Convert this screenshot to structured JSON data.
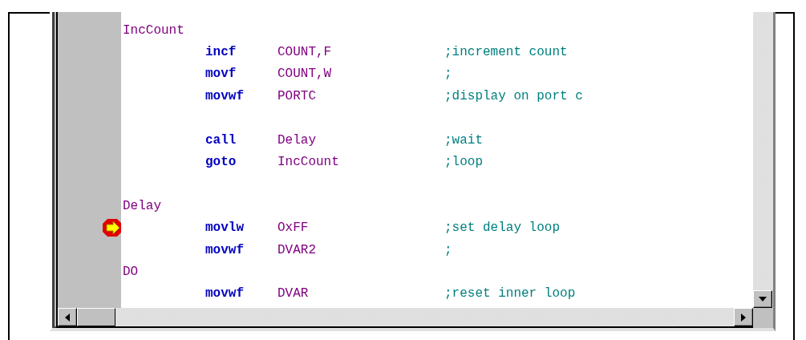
{
  "source_window": {
    "lines": [
      {
        "kind": "label",
        "label": "IncCount",
        "at_breakpoint": false
      },
      {
        "kind": "instruction",
        "mnemonic": "incf",
        "operand": "COUNT,F",
        "comment": ";increment count",
        "at_breakpoint": false
      },
      {
        "kind": "instruction",
        "mnemonic": "movf",
        "operand": "COUNT,W",
        "comment": ";",
        "at_breakpoint": false
      },
      {
        "kind": "instruction",
        "mnemonic": "movwf",
        "operand": "PORTC",
        "comment": ";display on port c",
        "at_breakpoint": false
      },
      {
        "kind": "blank",
        "at_breakpoint": false
      },
      {
        "kind": "instruction",
        "mnemonic": "call",
        "operand": "Delay",
        "comment": ";wait",
        "at_breakpoint": false
      },
      {
        "kind": "instruction",
        "mnemonic": "goto",
        "operand": "IncCount",
        "comment": ";loop",
        "at_breakpoint": false
      },
      {
        "kind": "blank",
        "at_breakpoint": false
      },
      {
        "kind": "label",
        "label": "Delay",
        "at_breakpoint": false
      },
      {
        "kind": "instruction",
        "mnemonic": "movlw",
        "operand": "OxFF",
        "comment": ";set delay loop",
        "at_breakpoint": true
      },
      {
        "kind": "instruction",
        "mnemonic": "movwf",
        "operand": "DVAR2",
        "comment": ";",
        "at_breakpoint": false
      },
      {
        "kind": "label",
        "label": "DO",
        "at_breakpoint": false
      },
      {
        "kind": "instruction",
        "mnemonic": "movwf",
        "operand": "DVAR",
        "comment": ";reset inner loop",
        "at_breakpoint": false
      }
    ]
  }
}
